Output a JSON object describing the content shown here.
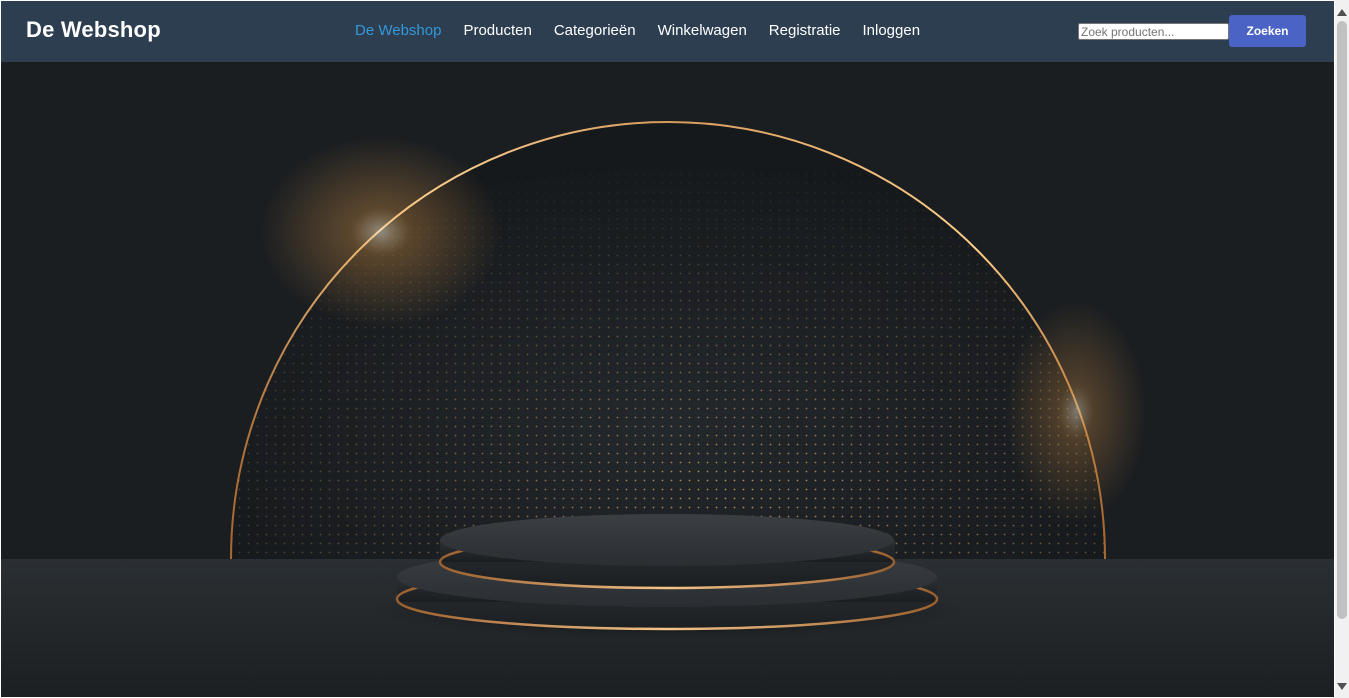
{
  "header": {
    "brand": "De Webshop",
    "nav": [
      {
        "label": "De Webshop",
        "active": true
      },
      {
        "label": "Producten",
        "active": false
      },
      {
        "label": "Categorieën",
        "active": false
      },
      {
        "label": "Winkelwagen",
        "active": false
      },
      {
        "label": "Registratie",
        "active": false
      },
      {
        "label": "Inloggen",
        "active": false
      }
    ],
    "search": {
      "placeholder": "Zoek producten...",
      "value": "",
      "button_label": "Zoeken"
    }
  },
  "colors": {
    "header_bg": "#2c3e50",
    "active_link": "#3498db",
    "button_bg": "#4a63c5",
    "hero_bg": "#1a1d20",
    "gold": "#d9a25e"
  },
  "hero": {
    "image": "golden-arch-podium-banner"
  }
}
